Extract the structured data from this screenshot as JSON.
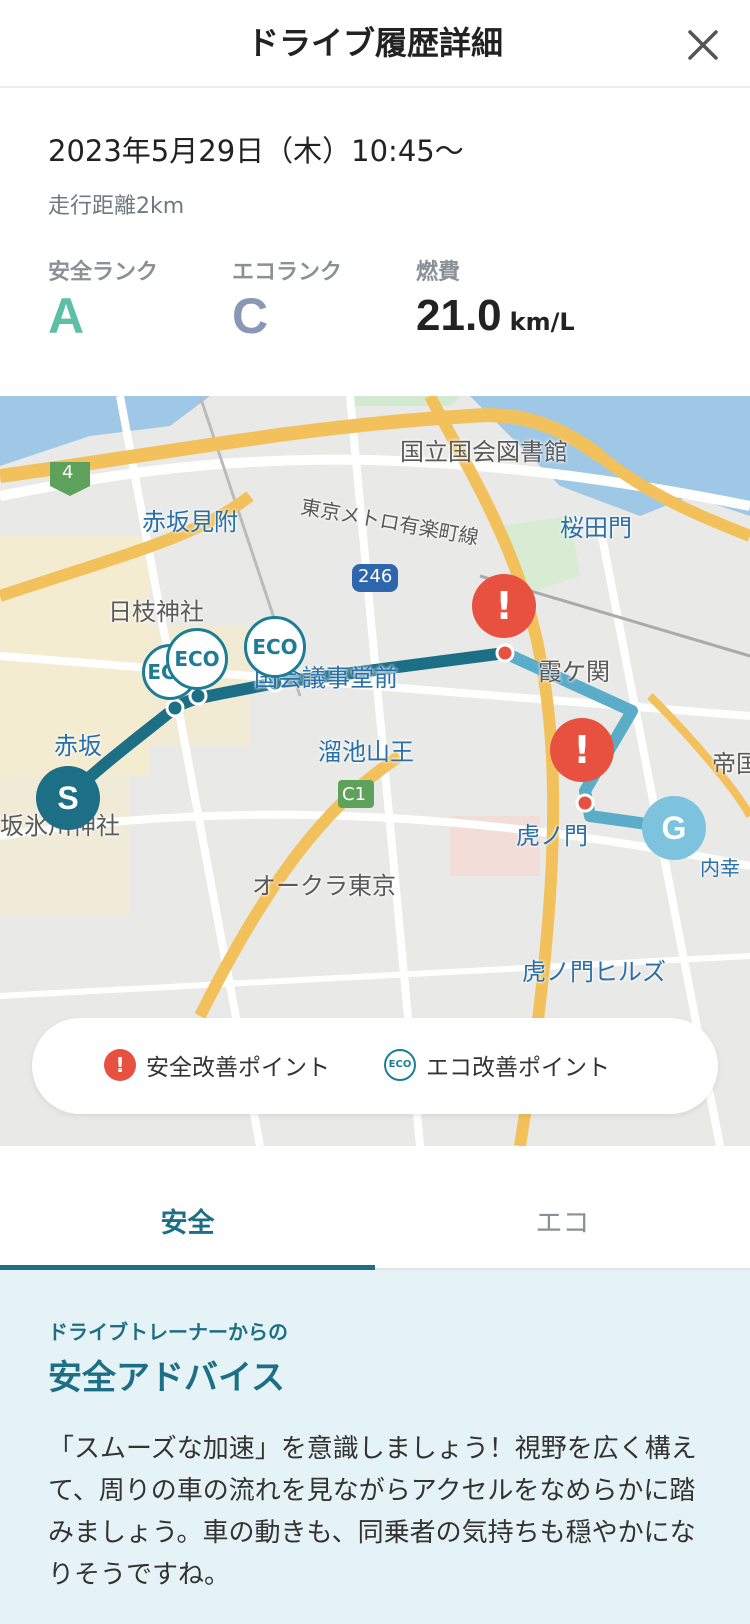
{
  "header": {
    "title": "ドライブ履歴詳細",
    "close_icon": "close-icon"
  },
  "summary": {
    "date": "2023年5月29日（木）10:45〜",
    "distance": "走行距離2km",
    "safety_rank": {
      "label": "安全ランク",
      "value": "A",
      "color": "#5cbfa6"
    },
    "eco_rank": {
      "label": "エコランク",
      "value": "C",
      "color": "#8a98b5"
    },
    "fuel": {
      "label": "燃費",
      "value": "21.0",
      "unit": "km/L"
    }
  },
  "map": {
    "labels": {
      "library": "国立国会図書館",
      "akasaka_mitsuke": "赤坂見附",
      "metro_line": "東京メトロ有楽町線",
      "sakuradamon": "桜田門",
      "hie_jinja": "日枝神社",
      "kokkai": "国会議事堂前",
      "kasumigaseki": "霞ケ関",
      "tameike": "溜池山王",
      "akasaka": "赤坂",
      "hikawa": "坂氷川神社",
      "toranomon": "虎ノ門",
      "okura": "オークラ東京",
      "toranomon_hills": "虎ノ門ヒルズ",
      "teikoku": "帝国",
      "uchisaiwai": "内幸",
      "route_4": "4",
      "route_246": "246",
      "route_c1": "C1"
    },
    "start_marker": "S",
    "goal_marker": "G",
    "eco_marker_label": "ECO",
    "alert_marker_label": "!",
    "route_color": "#1d6f86",
    "route_color_light": "#5bacc9",
    "alert_color": "#e8513f"
  },
  "legend": {
    "safety": {
      "label": "安全改善ポイント",
      "icon": "alert-icon"
    },
    "eco": {
      "label": "エコ改善ポイント",
      "icon": "eco-icon",
      "icon_text": "ECO"
    }
  },
  "tabs": [
    {
      "label": "安全",
      "active": true
    },
    {
      "label": "エコ",
      "active": false
    }
  ],
  "advice": {
    "subtitle": "ドライブトレーナーからの",
    "title": "安全アドバイス",
    "body": "「スムーズな加速」を意識しましょう！視野を広く構えて、周りの車の流れを見ながらアクセルをなめらかに踏みましょう。車の動きも、同乗者の気持ちも穏やかになりそうですね。"
  }
}
